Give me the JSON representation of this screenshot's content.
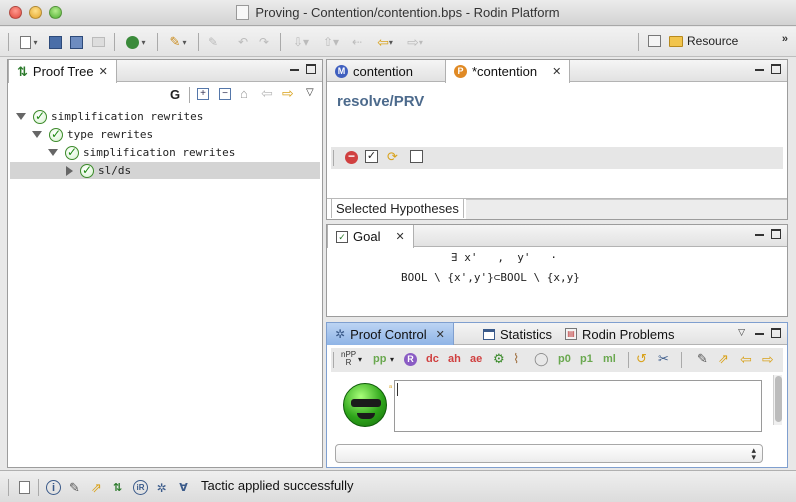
{
  "window": {
    "title": "Proving - Contention/contention.bps - Rodin Platform"
  },
  "toolbar": {
    "perspective_label": "Resource",
    "overflow": "»"
  },
  "proof_tree": {
    "tab_label": "Proof Tree",
    "filter_label": "G",
    "nodes": [
      {
        "label": "simplification rewrites",
        "expanded": true
      },
      {
        "label": "type rewrites",
        "expanded": true
      },
      {
        "label": "simplification rewrites",
        "expanded": true
      },
      {
        "label": "sl/ds",
        "expanded": false,
        "selected": true
      }
    ]
  },
  "editor": {
    "tabs": [
      {
        "label": "contention",
        "badge": "M"
      },
      {
        "label": "*contention",
        "badge": "P"
      }
    ],
    "heading": "resolve/PRV",
    "selected_hypotheses_label": "Selected Hypotheses"
  },
  "goal": {
    "tab_label": "Goal",
    "line1": "∃ x'   ,  y'   ·",
    "line2": "BOOL \\ {x',y'}⊂BOOL \\ {x,y}"
  },
  "proof_control": {
    "tabs": [
      {
        "label": "Proof Control"
      },
      {
        "label": "Statistics"
      },
      {
        "label": "Rodin Problems"
      }
    ],
    "buttons": {
      "npp": "nPP",
      "npp_sub": "R",
      "pp": "pp",
      "r": "R",
      "dc": "dc",
      "ah": "ah",
      "ae": "ae",
      "p0": "p0",
      "p1": "p1",
      "ml": "ml"
    },
    "input_value": ""
  },
  "status": {
    "message": "Tactic applied successfully"
  },
  "colors": {
    "accent_blue": "#8fb4e6",
    "success_green": "#1d8a12",
    "tactic_red": "#d04040",
    "tactic_green": "#6aa84f"
  }
}
